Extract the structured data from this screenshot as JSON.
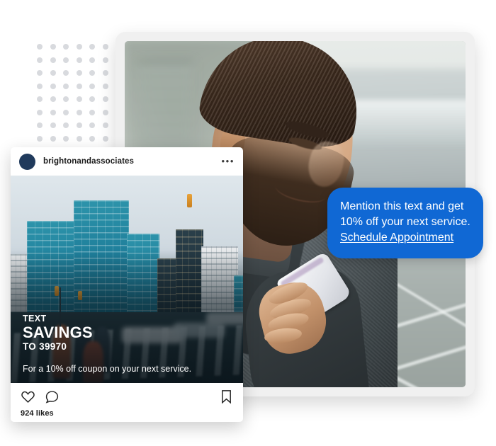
{
  "colors": {
    "bubble_blue": "#1068d4",
    "avatar_navy": "#203a5c",
    "dot_grey": "#d8dade",
    "card_white": "#ffffff",
    "frame_grey": "#f0f0f0"
  },
  "decoration": {
    "dot_grid": {
      "name": "dot-grid-pattern",
      "columns": 7,
      "rows": 8,
      "dot_color": "#d8dade"
    }
  },
  "photo_card": {
    "name": "lifestyle-photo-card",
    "alt": "Smiling bearded man in a grey wool coat looking down at a white smartphone on a city platform"
  },
  "message_bubble": {
    "line1": "Mention this text and get",
    "line2": "10% off your next service.",
    "link": "Schedule Appointment"
  },
  "instagram_post": {
    "username": "brightonandassociates",
    "more_label": "•••",
    "photo_alt": "Teal glass skyscrapers above a motion-blurred city crosswalk",
    "overlay": {
      "text_label": "TEXT",
      "keyword": "SAVINGS",
      "to_label": "TO 39970",
      "subtext": "For a 10% off coupon on your next service."
    },
    "actions": {
      "like_icon": "heart-icon",
      "comment_icon": "comment-icon",
      "bookmark_icon": "bookmark-icon"
    },
    "likes": "924 likes"
  }
}
